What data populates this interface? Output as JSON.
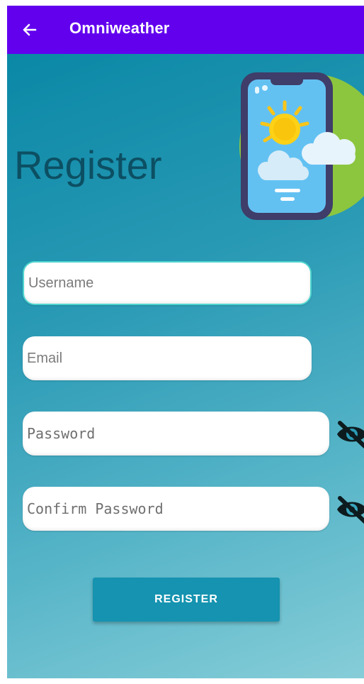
{
  "appbar": {
    "title": "Omniweather",
    "back_icon": "arrow-back-icon",
    "color": "#6200ee"
  },
  "page": {
    "heading": "Register",
    "illustration": "phone-weather-illustration"
  },
  "form": {
    "username": {
      "placeholder": "Username",
      "value": "",
      "focused": true
    },
    "email": {
      "placeholder": "Email",
      "value": ""
    },
    "password": {
      "placeholder": "Password",
      "value": "",
      "toggle_icon": "eye-off-icon"
    },
    "confirm_password": {
      "placeholder": "Confirm Password",
      "value": "",
      "toggle_icon": "eye-off-icon"
    }
  },
  "actions": {
    "register_label": "REGISTER",
    "register_color": "#1593b0"
  }
}
